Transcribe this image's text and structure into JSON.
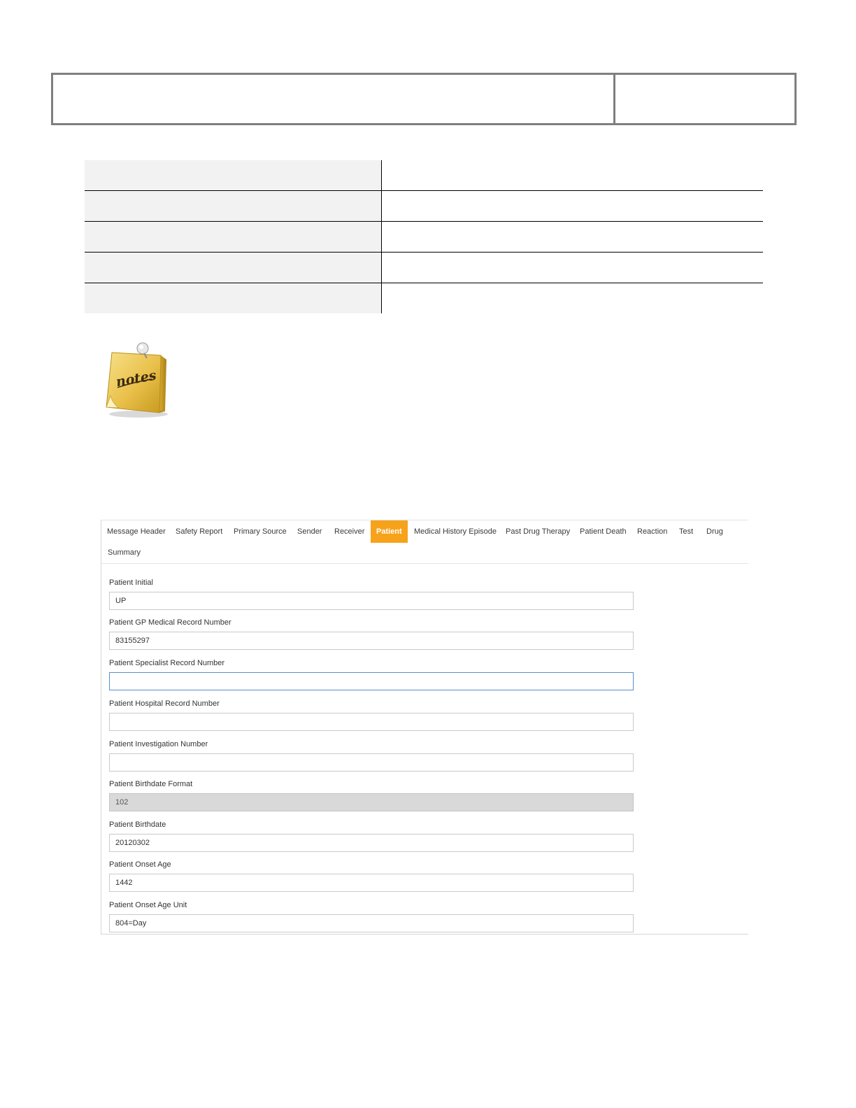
{
  "tabs": [
    {
      "label": "Message Header",
      "active": false
    },
    {
      "label": "Safety Report",
      "active": false
    },
    {
      "label": "Primary Source",
      "active": false
    },
    {
      "label": "Sender",
      "active": false
    },
    {
      "label": "Receiver",
      "active": false
    },
    {
      "label": "Patient",
      "active": true
    },
    {
      "label": "Medical History Episode",
      "active": false
    },
    {
      "label": "Past Drug Therapy",
      "active": false
    },
    {
      "label": "Patient Death",
      "active": false
    },
    {
      "label": "Reaction",
      "active": false
    },
    {
      "label": "Test",
      "active": false
    },
    {
      "label": "Drug",
      "active": false
    },
    {
      "label": "Summary",
      "active": false
    }
  ],
  "fields": [
    {
      "label": "Patient Initial",
      "value": "UP",
      "state": "normal"
    },
    {
      "label": "Patient GP Medical Record Number",
      "value": "83155297",
      "state": "normal"
    },
    {
      "label": "Patient Specialist Record Number",
      "value": "",
      "state": "focused"
    },
    {
      "label": "Patient Hospital Record Number",
      "value": "",
      "state": "normal"
    },
    {
      "label": "Patient Investigation Number",
      "value": "",
      "state": "normal"
    },
    {
      "label": "Patient Birthdate Format",
      "value": "102",
      "state": "disabled"
    },
    {
      "label": "Patient Birthdate",
      "value": "20120302",
      "state": "normal"
    },
    {
      "label": "Patient Onset Age",
      "value": "1442",
      "state": "normal"
    },
    {
      "label": "Patient Onset Age Unit",
      "value": "804=Day",
      "state": "normal"
    }
  ],
  "notes_icon": {
    "icon": "notes-icon",
    "text": "notes"
  },
  "colors": {
    "active_tab": "#f7a21b",
    "disabled_field": "#d9d9d9",
    "focus_border": "#5a8fc8"
  }
}
